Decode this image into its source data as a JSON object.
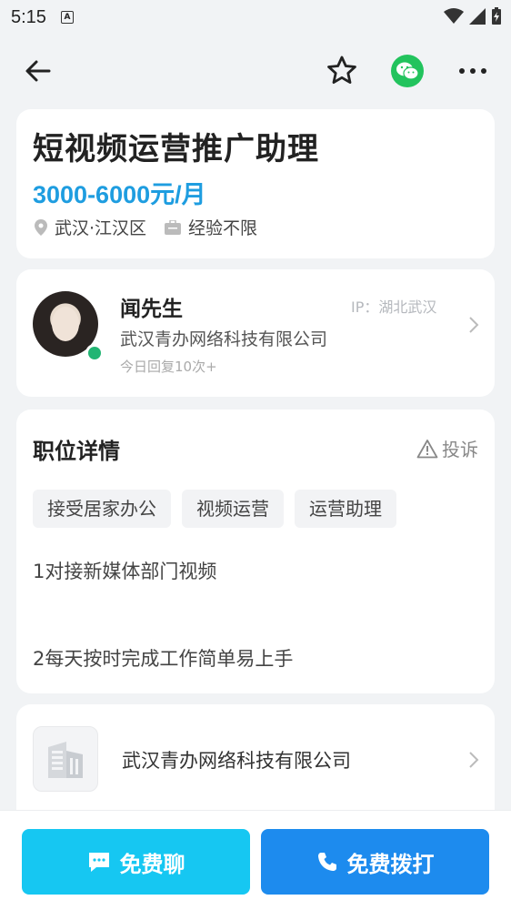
{
  "status": {
    "time": "5:15",
    "badge": "A"
  },
  "job": {
    "title": "短视频运营推广助理",
    "salary": "3000-6000元/月",
    "location": "武汉·江汉区",
    "experience": "经验不限"
  },
  "recruiter": {
    "name": "闻先生",
    "ip": "IP：湖北武汉",
    "company": "武汉青办网络科技有限公司",
    "reply": "今日回复10次+"
  },
  "detail": {
    "title": "职位详情",
    "report": "投诉",
    "tags": [
      "接受居家办公",
      "视频运营",
      "运营助理"
    ],
    "lines": [
      "1对接新媒体部门视频",
      "2每天按时完成工作简单易上手"
    ]
  },
  "company": {
    "name": "武汉青办网络科技有限公司"
  },
  "actions": {
    "chat": "免费聊",
    "call": "免费拨打"
  },
  "colors": {
    "salary": "#1e9de0",
    "chat_button": "#16c7f2",
    "call_button": "#1d8bee",
    "wechat": "#22c35d",
    "online": "#22b573"
  }
}
